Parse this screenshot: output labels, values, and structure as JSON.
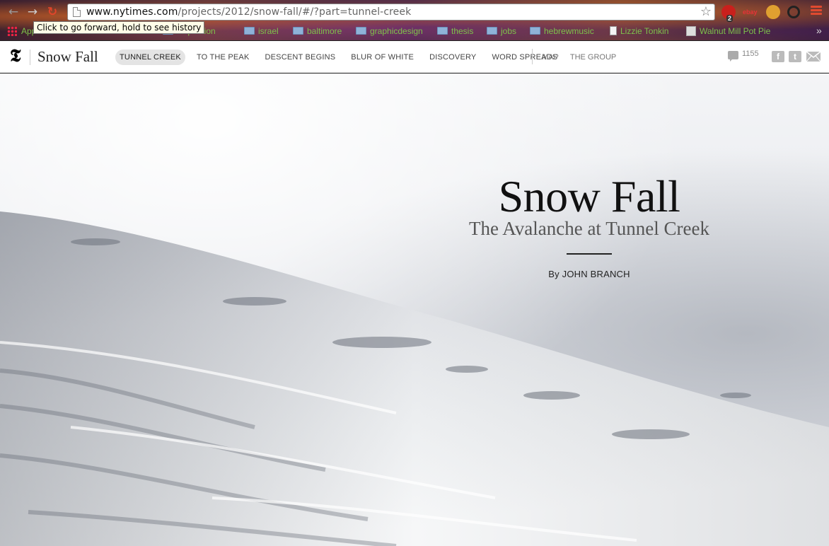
{
  "browser": {
    "url_host": "www.nytimes.com",
    "url_path": "/projects/2012/snow-fall/#/?part=tunnel-creek",
    "tooltip": "Click to go forward, hold to see history",
    "back_icon": "arrow-left-icon",
    "forward_icon": "arrow-right-icon",
    "reload_icon": "reload-icon",
    "star_icon": "star-icon",
    "extensions": {
      "adblock_badge": "2",
      "ebay_label": "ebay"
    },
    "bookmarks": [
      {
        "label": "Apps",
        "kind": "apps"
      },
      {
        "label": "inspiration",
        "kind": "folder"
      },
      {
        "label": "israel",
        "kind": "folder"
      },
      {
        "label": "baltimore",
        "kind": "folder"
      },
      {
        "label": "graphicdesign",
        "kind": "folder"
      },
      {
        "label": "thesis",
        "kind": "folder"
      },
      {
        "label": "jobs",
        "kind": "folder"
      },
      {
        "label": "hebrewmusic",
        "kind": "folder"
      },
      {
        "label": "Lizzie Tonkin",
        "kind": "page"
      },
      {
        "label": "Walnut Mill Pot Pie",
        "kind": "image"
      }
    ],
    "bookmarks_overflow": "»"
  },
  "header": {
    "logo": "𝕿",
    "site_title": "Snow Fall",
    "chapters": [
      {
        "label": "TUNNEL CREEK",
        "active": true
      },
      {
        "label": "TO THE PEAK",
        "active": false
      },
      {
        "label": "DESCENT BEGINS",
        "active": false
      },
      {
        "label": "BLUR OF WHITE",
        "active": false
      },
      {
        "label": "DISCOVERY",
        "active": false
      },
      {
        "label": "WORD SPREADS",
        "active": false
      }
    ],
    "extra_links": [
      "MAP",
      "THE GROUP"
    ],
    "comment_count": "1155",
    "share": {
      "facebook": "f",
      "twitter": "t"
    }
  },
  "hero": {
    "title": "Snow Fall",
    "subtitle": "The Avalanche at Tunnel Creek",
    "byline": "By JOHN BRANCH"
  }
}
